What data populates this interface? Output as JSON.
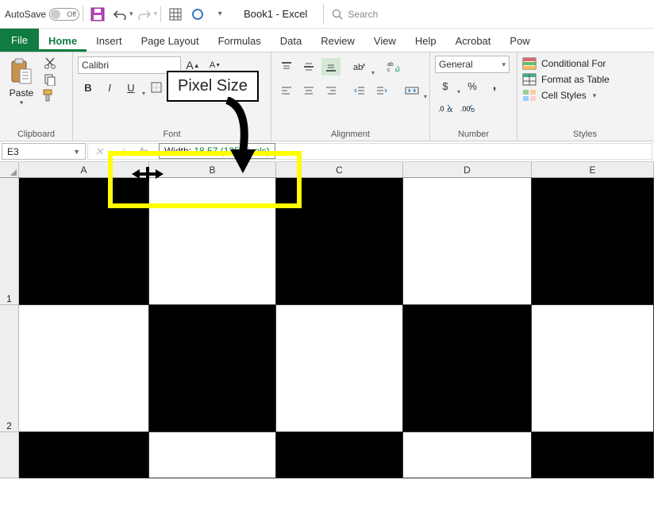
{
  "titlebar": {
    "autosave_label": "AutoSave",
    "autosave_state": "Off",
    "doc_title": "Book1 - Excel",
    "search_placeholder": "Search"
  },
  "tabs": {
    "file": "File",
    "items": [
      "Home",
      "Insert",
      "Page Layout",
      "Formulas",
      "Data",
      "Review",
      "View",
      "Help",
      "Acrobat",
      "Pow"
    ]
  },
  "ribbon": {
    "clipboard": {
      "label": "Clipboard",
      "paste": "Paste"
    },
    "font": {
      "label": "Font",
      "name": "Calibri",
      "bold": "B",
      "italic": "I",
      "underline": "U"
    },
    "alignment": {
      "label": "Alignment"
    },
    "number": {
      "label": "Number",
      "format": "General",
      "currency": "$",
      "percent": "%",
      "comma": ","
    },
    "styles": {
      "label": "Styles",
      "conditional": "Conditional For",
      "table": "Format as Table",
      "cell": "Cell Styles"
    }
  },
  "formula_bar": {
    "cell_ref": "E3",
    "fx": "fx"
  },
  "resize_tooltip": {
    "prefix": "Width: ",
    "value": "18.57 (135 pixels)"
  },
  "columns": [
    "A",
    "B",
    "C",
    "D",
    "E"
  ],
  "rows": [
    "1",
    "2"
  ],
  "annotation": {
    "label": "Pixel Size"
  }
}
